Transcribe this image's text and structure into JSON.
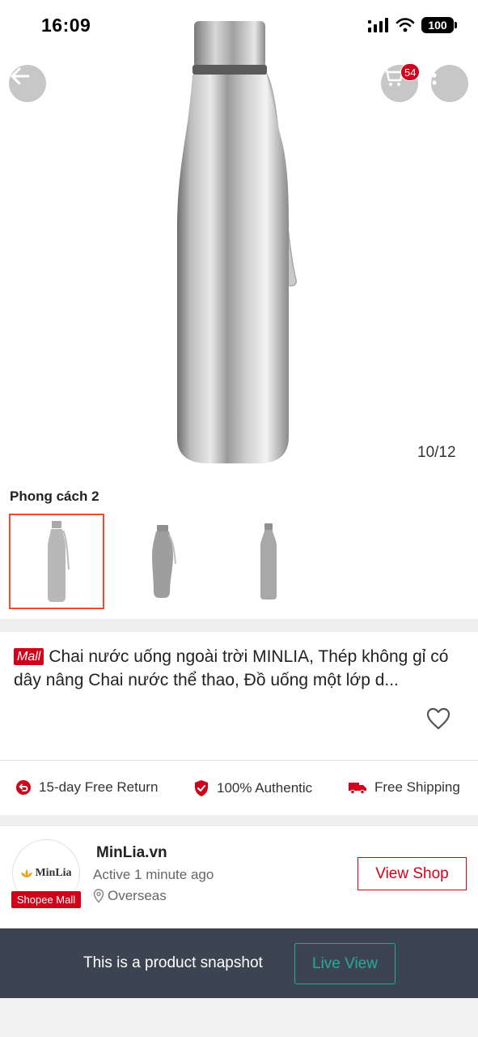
{
  "status_bar": {
    "time": "16:09",
    "battery": "100"
  },
  "header": {
    "cart_count": "54"
  },
  "gallery": {
    "page_indicator": "10/12"
  },
  "variants": {
    "label": "Phong cách 2",
    "selected_index": 0
  },
  "product": {
    "mall_badge": "Mall",
    "title": "Chai nước uống ngoài trời MINLIA, Thép không gỉ có dây nâng Chai nước thể thao, Đồ uống một lớp d..."
  },
  "guarantees": [
    {
      "icon": "return-icon",
      "label": "15-day Free Return"
    },
    {
      "icon": "authentic-shield-icon",
      "label": "100% Authentic"
    },
    {
      "icon": "truck-icon",
      "label": "Free Shipping"
    }
  ],
  "shop": {
    "logo_text": "MinLia",
    "badge": "Shopee Mall",
    "name": "MinLia.vn",
    "active": "Active 1 minute ago",
    "location": "Overseas",
    "view_button": "View Shop"
  },
  "snapshot": {
    "message": "This is a product snapshot",
    "live_view": "Live View"
  },
  "colors": {
    "brand_red": "#d0011b",
    "shopee_orange": "#ee4d2d",
    "teal": "#26aa99",
    "snapshot_bg": "#3d4451"
  }
}
